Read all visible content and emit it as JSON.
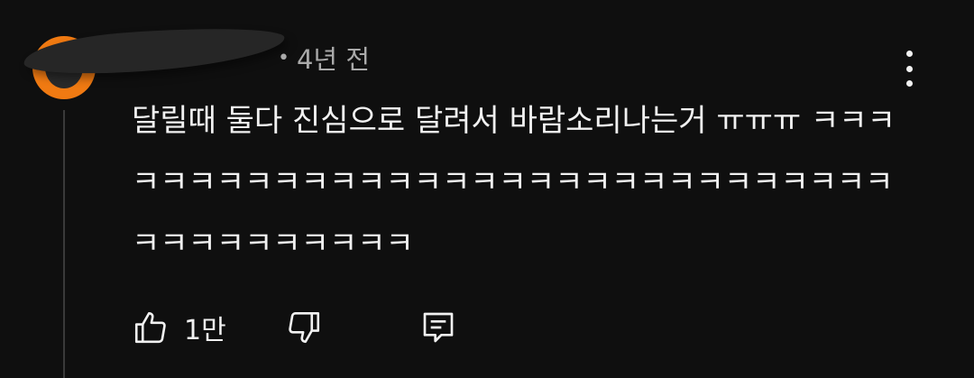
{
  "comment": {
    "time_ago": "4년 전",
    "separator": "•",
    "text": "달릴때 둘다 진심으로 달려서 바람소리나는거 ㅠㅠㅠ ㅋㅋㅋㅋㅋㅋㅋㅋㅋㅋㅋㅋㅋㅋㅋㅋㅋㅋㅋㅋㅋㅋㅋㅋㅋㅋㅋㅋㅋㅋㅋㅋㅋㅋㅋㅋㅋㅋㅋㅋ",
    "like_count": "1만"
  },
  "icons": {
    "more": "vertical-ellipsis-icon",
    "like": "thumbs-up-icon",
    "dislike": "thumbs-down-icon",
    "reply": "reply-comment-icon"
  },
  "colors": {
    "background": "#0f0f0f",
    "avatar": "#f07a12",
    "secondary_text": "#aaaaaa",
    "primary_text": "#f1f1f1"
  }
}
